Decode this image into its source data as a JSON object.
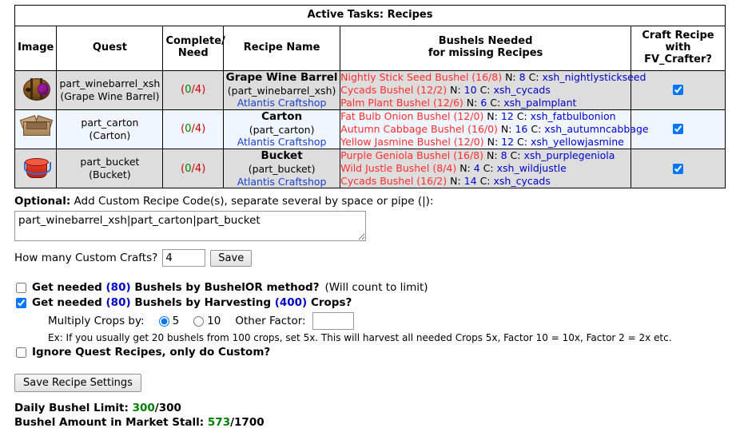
{
  "table": {
    "title": "Active Tasks: Recipes",
    "headers": {
      "image": "Image",
      "quest": "Quest",
      "complete_need_l1": "Complete/",
      "complete_need_l2": "Need",
      "recipe_name": "Recipe Name",
      "bushels_l1": "Bushels Needed",
      "bushels_l2": "for missing Recipes",
      "craft_l1": "Craft Recipe with",
      "craft_l2": "FV_Crafter?"
    },
    "rows": [
      {
        "icon": "wine-barrel-icon",
        "quest_code": "part_winebarrel_xsh",
        "quest_name": "(Grape Wine Barrel)",
        "complete": "0",
        "need": "4",
        "recipe_name": "Grape Wine Barrel",
        "recipe_code": "(part_winebarrel_xsh)",
        "recipe_shop": "Atlantis Craftshop",
        "bushels": [
          {
            "name": "Nightly Stick Seed Bushel (16/8)",
            "n_label": "N:",
            "n": "8",
            "c_label": "C:",
            "code": "xsh_nightlystickseed"
          },
          {
            "name": "Cycads Bushel (12/2)",
            "n_label": "N:",
            "n": "10",
            "c_label": "C:",
            "code": "xsh_cycads"
          },
          {
            "name": "Palm Plant Bushel (12/6)",
            "n_label": "N:",
            "n": "6",
            "c_label": "C:",
            "code": "xsh_palmplant"
          }
        ],
        "craft_checked": true
      },
      {
        "icon": "carton-icon",
        "quest_code": "part_carton",
        "quest_name": "(Carton)",
        "complete": "0",
        "need": "4",
        "recipe_name": "Carton",
        "recipe_code": "(part_carton)",
        "recipe_shop": "Atlantis Craftshop",
        "bushels": [
          {
            "name": "Fat Bulb Onion Bushel (12/0)",
            "n_label": "N:",
            "n": "12",
            "c_label": "C:",
            "code": "xsh_fatbulbonion"
          },
          {
            "name": "Autumn Cabbage Bushel (16/0)",
            "n_label": "N:",
            "n": "16",
            "c_label": "C:",
            "code": "xsh_autumncabbage"
          },
          {
            "name": "Yellow Jasmine Bushel (12/0)",
            "n_label": "N:",
            "n": "12",
            "c_label": "C:",
            "code": "xsh_yellowjasmine"
          }
        ],
        "craft_checked": true
      },
      {
        "icon": "bucket-icon",
        "quest_code": "part_bucket",
        "quest_name": "(Bucket)",
        "complete": "0",
        "need": "4",
        "recipe_name": "Bucket",
        "recipe_code": "(part_bucket)",
        "recipe_shop": "Atlantis Craftshop",
        "bushels": [
          {
            "name": "Purple Geniola Bushel (16/8)",
            "n_label": "N:",
            "n": "8",
            "c_label": "C:",
            "code": "xsh_purplegeniola"
          },
          {
            "name": "Wild Justle Bushel (8/4)",
            "n_label": "N:",
            "n": "4",
            "c_label": "C:",
            "code": "xsh_wildjustle"
          },
          {
            "name": "Cycads Bushel (16/2)",
            "n_label": "N:",
            "n": "14",
            "c_label": "C:",
            "code": "xsh_cycads"
          }
        ],
        "craft_checked": true
      }
    ]
  },
  "form": {
    "optional_bold": "Optional:",
    "optional_text": "Add Custom Recipe Code(s), separate several by space or pipe (|):",
    "custom_codes_value": "part_winebarrel_xsh|part_carton|part_bucket",
    "custom_codes_placeholder": "",
    "crafts_label": "How many Custom Crafts?",
    "crafts_value": "4",
    "save_label": "Save"
  },
  "options": {
    "bushelor": {
      "pre": "Get needed",
      "count": "(80)",
      "post": "Bushels by BushelOR method?",
      "note": "(Will count to limit)",
      "checked": false
    },
    "harvest": {
      "pre": "Get needed",
      "count": "(80)",
      "mid": "Bushels by Harvesting",
      "crops": "(400)",
      "post": "Crops?",
      "checked": true
    },
    "multiply": {
      "label": "Multiply Crops by:",
      "opt5": "5",
      "opt10": "10",
      "selected": "5",
      "other_label": "Other Factor:",
      "other_value": "",
      "other_placeholder": ""
    },
    "example": "Ex: If you usually get 20 bushels from 100 crops, set 5x. This will harvest all needed Crops 5x, Factor 10 = 10x, Factor 2 = 2x etc.",
    "ignore": {
      "label": "Ignore Quest Recipes, only do Custom?",
      "checked": false
    }
  },
  "footer": {
    "save_settings_label": "Save Recipe Settings",
    "daily_label": "Daily Bushel Limit:",
    "daily_current": "300",
    "daily_sep": "/",
    "daily_max": "300",
    "stall_label": "Bushel Amount in Market Stall:",
    "stall_current": "573",
    "stall_sep": "/",
    "stall_max": "1700"
  },
  "colors": {
    "bushel_name": "#ff2d2d",
    "link": "#0000cc",
    "green": "#008000",
    "red": "#cc0000"
  }
}
